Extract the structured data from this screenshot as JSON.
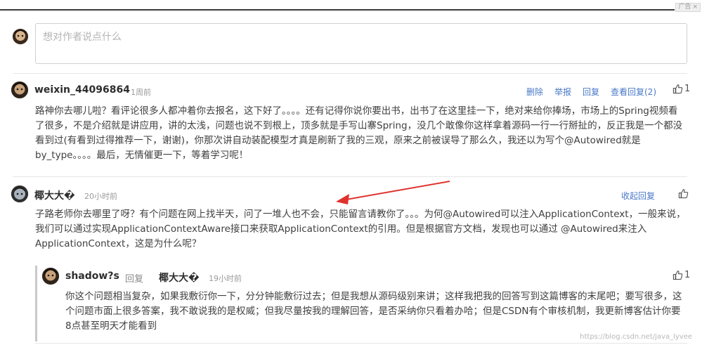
{
  "ad_badge": {
    "label": "广告",
    "close": "×"
  },
  "compose": {
    "placeholder": "想对作者说点什么"
  },
  "comments": [
    {
      "author": "weixin_44096864",
      "time": "1周前",
      "actions": [
        "删除",
        "举报",
        "回复",
        "查看回复(2)"
      ],
      "likes": "1",
      "body": "路神你去哪儿啦？看评论很多人都冲着你去报名，这下好了。。。。还有记得你说你要出书，出书了在这里挂一下，绝对来给你捧场，市场上的Spring视频看了很多，不是介绍就是讲应用，讲的太浅，问题也说不到根上，顶多就是手写山寨Spring，没几个敢像你这样拿着源码一行一行掰扯的，反正我是一个都没看到过(有看到过得推荐一下，谢谢)，你那次讲自动装配模型才真是刷新了我的三观，原来之前被误导了那么久，我还以为写个@Autowired就是by_type。。。。最后，无情催更一下，等着学习呢！"
    },
    {
      "author": "椰大大�",
      "time": "20小时前",
      "actions": [
        "收起回复"
      ],
      "likes": "",
      "body": "子路老师你去哪里了呀？有个问题在网上找半天，问了一堆人也不会，只能留言请教你了。。。为何@Autowired可以注入ApplicationContext，一般来说，我们可以通过实现ApplicationContextAware接口来获取ApplicationContext的引用。但是根据官方文档，发现也可以通过 @Autowired来注入ApplicationContext，这是为什么呢？"
    }
  ],
  "reply": {
    "author": "shadow?s",
    "reply_word": "回复",
    "target": "椰大大�",
    "time": "19小时前",
    "likes": "1",
    "body": "你这个问题相当复杂，如果我敷衍你一下，分分钟能敷衍过去；但是我想从源码级别来讲；这样我把我的回答写到这篇博客的末尾吧；要写很多，这个问题市面上很多答案，我不敢说我的是权威；但我尽量按我的理解回答，是否采纳你只看着办哈；但是CSDN有个审核机制，我更新博客估计你要8点甚至明天才能看到"
  },
  "watermark": "https://blog.csdn.net/java_lyvee",
  "colors": {
    "link": "#4a78c8",
    "arrow": "#e0322d"
  }
}
